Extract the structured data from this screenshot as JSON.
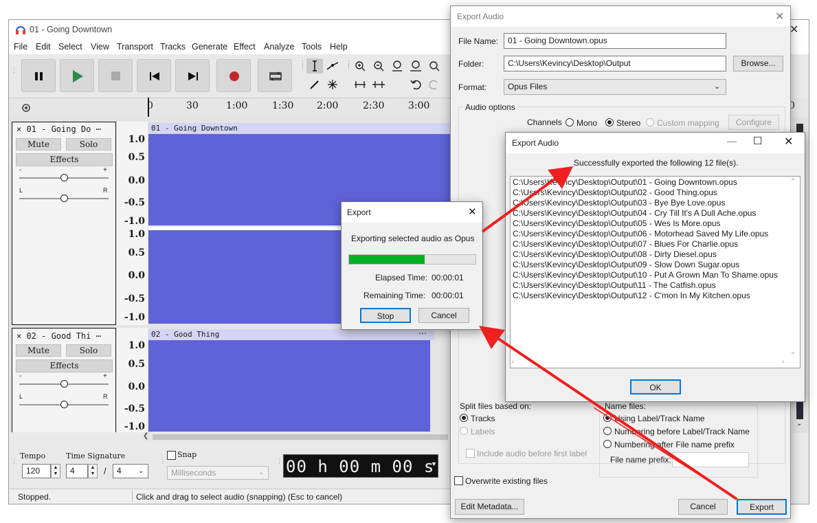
{
  "app": {
    "title": "01 - Going Downtown",
    "menu": [
      "File",
      "Edit",
      "Select",
      "View",
      "Transport",
      "Tracks",
      "Generate",
      "Effect",
      "Analyze",
      "Tools",
      "Help"
    ],
    "ruler": [
      "0",
      "30",
      "1:00",
      "1:30",
      "2:00",
      "2:30",
      "3:00"
    ],
    "tracks": [
      {
        "header": "× 01 - Going Do ⋯",
        "clip": "01 - Going Downtown",
        "mute": "Mute",
        "solo": "Solo",
        "effects": "Effects",
        "scale": [
          "1.0",
          "0.5",
          "0.0",
          "-0.5",
          "-1.0"
        ],
        "scale2": [
          "1.0",
          "0.5",
          "0.0",
          "-0.5",
          "-1.0"
        ]
      },
      {
        "header": "× 02 - Good Thi ⋯",
        "clip": "02 - Good Thing",
        "mute": "Mute",
        "solo": "Solo",
        "effects": "Effects",
        "scale": [
          "1.0",
          "0.5",
          "0.0",
          "-0.5",
          "-1.0"
        ]
      }
    ],
    "gain_minus": "-",
    "gain_plus": "+",
    "pan_l": "L",
    "pan_r": "R",
    "bottom": {
      "tempo_label": "Tempo",
      "tempo": "120",
      "timesig_label": "Time Signature",
      "timesig_num": "4",
      "timesig_den": "4",
      "slash": "/",
      "snap_label": "Snap",
      "snap_unit": "Milliseconds",
      "time": "00 h 00 m 00 s"
    },
    "status_left": "Stopped.",
    "status_right": "Click and drag to select audio (snapping) (Esc to cancel)"
  },
  "export_audio": {
    "title": "Export Audio",
    "file_name_label": "File Name:",
    "file_name": "01 - Going Downtown.opus",
    "folder_label": "Folder:",
    "folder": "C:\\Users\\Kevincy\\Desktop\\Output",
    "browse": "Browse...",
    "format_label": "Format:",
    "format": "Opus Files",
    "audio_options": "Audio options",
    "channels_label": "Channels",
    "mono": "Mono",
    "stereo": "Stereo",
    "custom": "Custom mapping",
    "configure": "Configure",
    "split_label": "Split files based on:",
    "split_tracks": "Tracks",
    "split_labels": "Labels",
    "include_audio": "Include audio before first label",
    "name_files_label": "Name files:",
    "name_opt1": "Using Label/Track Name",
    "name_opt2": "Numbering before Label/Track Name",
    "name_opt3": "Numbering after File name prefix",
    "prefix_label": "File name prefix:",
    "overwrite": "Overwrite existing files",
    "edit_metadata": "Edit Metadata...",
    "cancel": "Cancel",
    "export": "Export"
  },
  "success": {
    "title": "Export Audio",
    "message": "Successfully exported the following 12 file(s).",
    "files": [
      "C:\\Users\\Kevincy\\Desktop\\Output\\01 - Going Downtown.opus",
      "C:\\Users\\Kevincy\\Desktop\\Output\\02 - Good Thing.opus",
      "C:\\Users\\Kevincy\\Desktop\\Output\\03 - Bye Bye Love.opus",
      "C:\\Users\\Kevincy\\Desktop\\Output\\04 - Cry Till It's A Dull Ache.opus",
      "C:\\Users\\Kevincy\\Desktop\\Output\\05 - Wes Is More.opus",
      "C:\\Users\\Kevincy\\Desktop\\Output\\06 - Motorhead Saved My Life.opus",
      "C:\\Users\\Kevincy\\Desktop\\Output\\07 - Blues For Charlie.opus",
      "C:\\Users\\Kevincy\\Desktop\\Output\\08 - Dirty Diesel.opus",
      "C:\\Users\\Kevincy\\Desktop\\Output\\09 - Slow Down Sugar.opus",
      "C:\\Users\\Kevincy\\Desktop\\Output\\10 - Put A Grown Man To Shame.opus",
      "C:\\Users\\Kevincy\\Desktop\\Output\\11 - The Catfish.opus",
      "C:\\Users\\Kevincy\\Desktop\\Output\\12 - C'mon In My Kitchen.opus"
    ],
    "ok": "OK"
  },
  "progress": {
    "title": "Export",
    "message": "Exporting selected audio as Opus",
    "fraction": 0.6,
    "elapsed_label": "Elapsed Time:",
    "elapsed": "00:00:01",
    "remaining_label": "Remaining Time:",
    "remaining": "00:00:01",
    "stop": "Stop",
    "cancel": "Cancel"
  },
  "colors": {
    "wave": "#5f63d8",
    "progress": "#06b025",
    "arrow": "#ee2020",
    "record": "#c0282d",
    "play": "#2d8a4a"
  }
}
